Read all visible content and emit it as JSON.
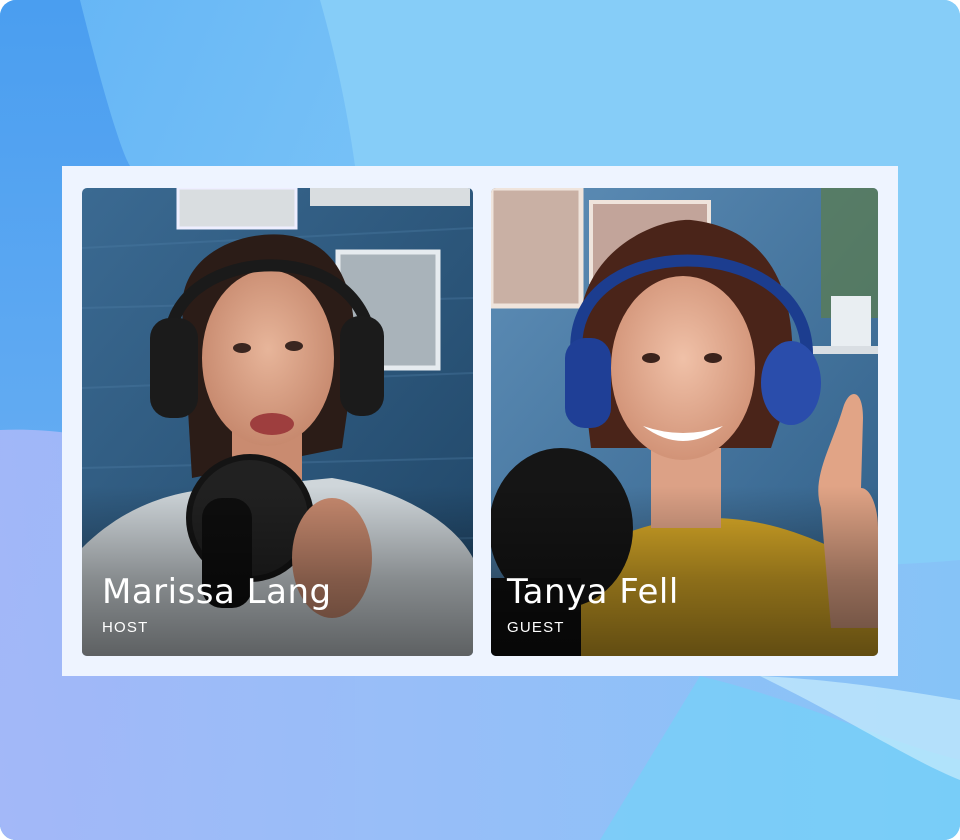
{
  "call": {
    "participants": [
      {
        "name": "Marissa Lang",
        "role": "HOST"
      },
      {
        "name": "Tanya Fell",
        "role": "GUEST"
      }
    ]
  },
  "colors": {
    "background_light": "#8fd3f8",
    "background_dark": "#4a9ef0",
    "frame": "#eef4ff",
    "wall_blue": "#2f5f86",
    "text": "#ffffff"
  }
}
